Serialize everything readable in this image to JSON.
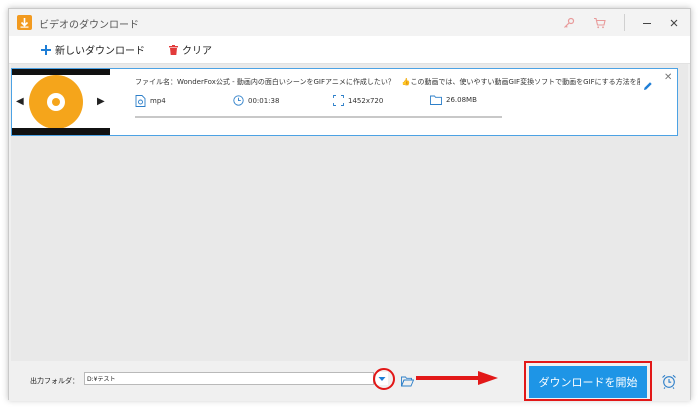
{
  "window": {
    "title": "ビデオのダウンロード",
    "accent_color": "#1e95e6",
    "icons": [
      "key-icon",
      "cart-icon",
      "minimize-icon",
      "close-icon"
    ]
  },
  "toolbar": {
    "new_download_label": "新しいダウンロード",
    "clear_label": "クリア"
  },
  "item": {
    "file_name": "ファイル名：WonderFox公式 - 動画内の面白いシーンをGIFアニメに作成したい？　👍この動画では、使いやすい動画GIF変換ソフトで動画をGIFにする方法を展示しております。...",
    "format": "mp4",
    "duration": "00:01:38",
    "resolution": "1452x720",
    "size": "26.08MB",
    "progress_percent": 0
  },
  "bottom": {
    "folder_label": "出力フォルダ：",
    "folder_value": "D:¥テスト",
    "download_label": "ダウンロードを開始"
  }
}
